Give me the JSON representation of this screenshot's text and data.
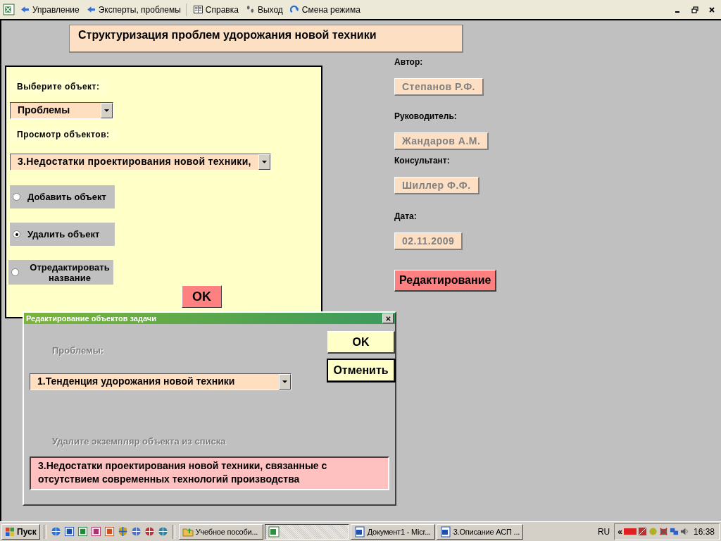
{
  "toolbar": {
    "items": [
      {
        "label": "Управление",
        "kind": "back"
      },
      {
        "label": "Эксперты, проблемы",
        "kind": "back"
      },
      {
        "label": "Справка",
        "kind": "book"
      },
      {
        "label": "Выход",
        "kind": "steps"
      },
      {
        "label": "Смена режима",
        "kind": "refresh"
      }
    ]
  },
  "title": "Структуризация проблем удорожания новой техники",
  "object_panel": {
    "select_label": "Выберите объект:",
    "select_value": "Проблемы",
    "view_label": "Просмотр объектов:",
    "view_value": "3.Недостатки проектирования новой техники,",
    "actions": [
      {
        "label": "Добавить объект",
        "selected": false
      },
      {
        "label": "Удалить объект",
        "selected": true
      },
      {
        "label": "Отредактировать название",
        "selected": false
      }
    ],
    "ok": "OK"
  },
  "info": [
    {
      "label": "Автор:",
      "value": "Степанов Р.Ф."
    },
    {
      "label": "Руководитель:",
      "value": "Жандаров А.М."
    },
    {
      "label": "Консультант:",
      "value": "Шиллер Ф.Ф."
    },
    {
      "label": "Дата:",
      "value": "02.11.2009"
    }
  ],
  "edit_button": "Редактирование",
  "dialog": {
    "title": "Редактирование объектов задачи",
    "list_label": "Проблемы:",
    "list_value": "1.Тенденция удорожания новой техники",
    "hint": "Удалите экземпляр объекта из списка",
    "selected_text": "3.Недостатки проектирования новой техники, связанные с отсутствием современных технологий производства",
    "ok": "OK",
    "cancel": "Отменить"
  },
  "taskbar": {
    "start": "Пуск",
    "tasks": [
      {
        "label": "Учебное пособи...",
        "kind": "folder"
      },
      {
        "kind": "sheet"
      },
      {
        "label": "Документ1 - Micr...",
        "kind": "doc"
      },
      {
        "label": "3.Описание АСП ...",
        "kind": "doc"
      }
    ],
    "language": "RU",
    "expand": "«",
    "clock": "16:38"
  }
}
